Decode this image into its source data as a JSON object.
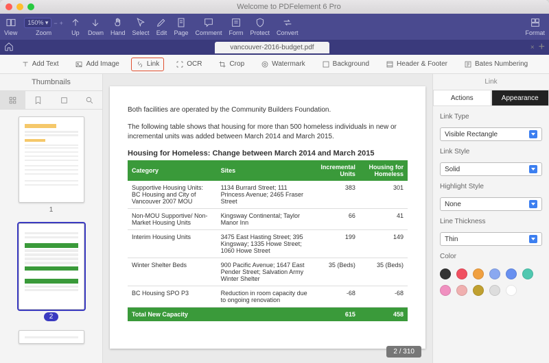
{
  "app_title": "Welcome to PDFelement 6 Pro",
  "zoom": "150%",
  "toolbar": [
    {
      "id": "view",
      "label": "View"
    },
    {
      "id": "zoom",
      "label": "Zoom"
    },
    {
      "id": "up",
      "label": "Up"
    },
    {
      "id": "down",
      "label": "Down"
    },
    {
      "id": "hand",
      "label": "Hand"
    },
    {
      "id": "select",
      "label": "Select"
    },
    {
      "id": "edit",
      "label": "Edit"
    },
    {
      "id": "page",
      "label": "Page"
    },
    {
      "id": "comment",
      "label": "Comment"
    },
    {
      "id": "form",
      "label": "Form"
    },
    {
      "id": "protect",
      "label": "Protect"
    },
    {
      "id": "convert",
      "label": "Convert"
    },
    {
      "id": "format",
      "label": "Format"
    }
  ],
  "open_tab": "vancouver-2016-budget.pdf",
  "edit_subbar": [
    {
      "id": "add-text",
      "label": "Add Text"
    },
    {
      "id": "add-image",
      "label": "Add Image"
    },
    {
      "id": "link",
      "label": "Link",
      "selected": true
    },
    {
      "id": "ocr",
      "label": "OCR"
    },
    {
      "id": "crop",
      "label": "Crop"
    },
    {
      "id": "watermark",
      "label": "Watermark"
    },
    {
      "id": "background",
      "label": "Background"
    },
    {
      "id": "header-footer",
      "label": "Header & Footer"
    },
    {
      "id": "bates",
      "label": "Bates Numbering"
    }
  ],
  "left_panel_title": "Thumbnails",
  "thumb_labels": {
    "p1": "1",
    "p2": "2"
  },
  "page_counter": "2 / 310",
  "document": {
    "para1": "Both facilities are operated by the Community Builders Foundation.",
    "para2": "The following table shows that housing for more than 500 homeless individuals in new or incremental units was added between March 2014 and March 2015.",
    "table_title": "Housing for Homeless: Change between March 2014 and March 2015",
    "headers": [
      "Category",
      "Sites",
      "Incremental Units",
      "Housing for Homeless"
    ],
    "rows": [
      {
        "c": "Supportive Housing Units: BC Housing and City of Vancouver 2007 MOU",
        "s": "1134 Burrard Street; 111 Princess Avenue; 2465 Fraser Street",
        "i": "383",
        "h": "301"
      },
      {
        "c": "Non-MOU Supportive/ Non-Market Housing Units",
        "s": "Kingsway Continental; Taylor Manor Inn",
        "i": "66",
        "h": "41"
      },
      {
        "c": "Interim Housing Units",
        "s": "3475 East Hasting Street; 395 Kingsway; 1335 Howe Street; 1060 Howe Street",
        "i": "199",
        "h": "149"
      },
      {
        "c": "Winter Shelter Beds",
        "s": "900 Pacific Avenue; 1647 East Pender Street; Salvation Army Winter Shelter",
        "i": "35 (Beds)",
        "h": "35 (Beds)"
      },
      {
        "c": "BC Housing SPO P3",
        "s": "Reduction in room capacity due to ongoing renovation",
        "i": "-68",
        "h": "-68"
      }
    ],
    "total": {
      "c": "Total New Capacity",
      "s": "",
      "i": "615",
      "h": "458"
    }
  },
  "right_panel": {
    "title": "Link",
    "tabs": {
      "actions": "Actions",
      "appearance": "Appearance"
    },
    "fields": {
      "link_type": {
        "label": "Link Type",
        "value": "Visible Rectangle"
      },
      "link_style": {
        "label": "Link Style",
        "value": "Solid"
      },
      "highlight_style": {
        "label": "Highlight Style",
        "value": "None"
      },
      "line_thickness": {
        "label": "Line Thickness",
        "value": "Thin"
      },
      "color_label": "Color"
    },
    "swatches": [
      "#333333",
      "#f05060",
      "#f0a040",
      "#8aa8f0",
      "#6890f0",
      "#50c8b0",
      "#f090c0",
      "#f0b0b0",
      "#c0a030",
      "#dddddd",
      "#ffffff"
    ]
  },
  "chart_data": {
    "type": "table",
    "title": "Housing for Homeless: Change between March 2014 and March 2015",
    "columns": [
      "Category",
      "Sites",
      "Incremental Units",
      "Housing for Homeless"
    ],
    "rows": [
      [
        "Supportive Housing Units: BC Housing and City of Vancouver 2007 MOU",
        "1134 Burrard Street; 111 Princess Avenue; 2465 Fraser Street",
        383,
        301
      ],
      [
        "Non-MOU Supportive/ Non-Market Housing Units",
        "Kingsway Continental; Taylor Manor Inn",
        66,
        41
      ],
      [
        "Interim Housing Units",
        "3475 East Hasting Street; 395 Kingsway; 1335 Howe Street; 1060 Howe Street",
        199,
        149
      ],
      [
        "Winter Shelter Beds",
        "900 Pacific Avenue; 1647 East Pender Street; Salvation Army Winter Shelter",
        35,
        35
      ],
      [
        "BC Housing SPO P3",
        "Reduction in room capacity due to ongoing renovation",
        -68,
        -68
      ],
      [
        "Total New Capacity",
        "",
        615,
        458
      ]
    ]
  }
}
